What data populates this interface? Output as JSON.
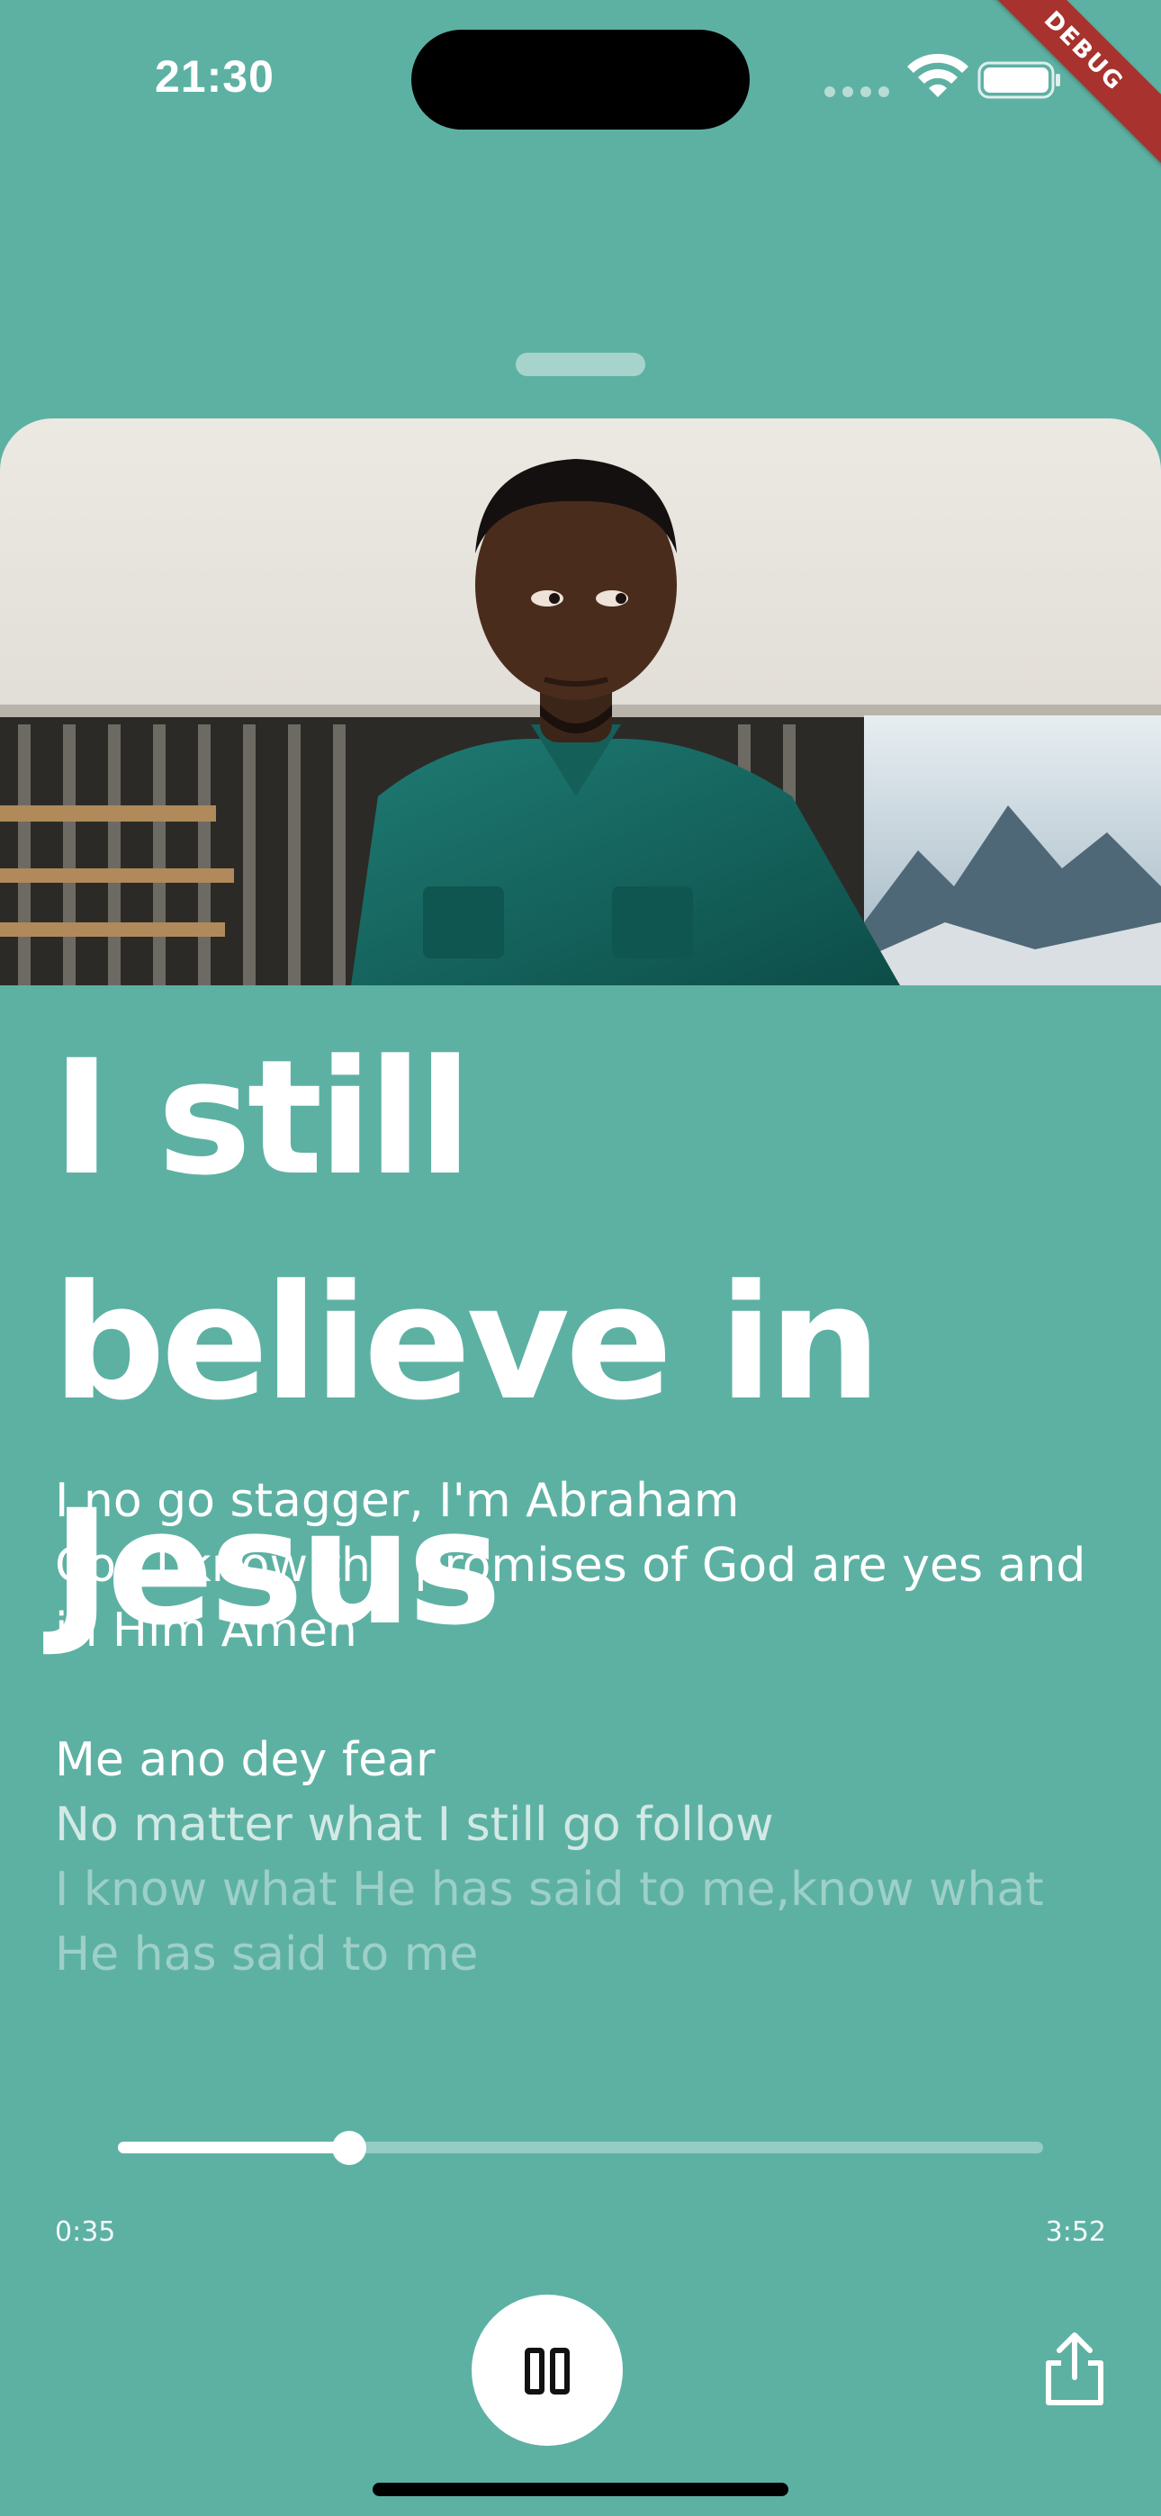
{
  "status_bar": {
    "time": "21:30",
    "debug_label": "DEBUG",
    "icons": [
      "signal-dots-icon",
      "wifi-icon",
      "battery-icon"
    ]
  },
  "song": {
    "title": "I still believe in Jesus",
    "artwork": "artist-photo"
  },
  "lyrics": {
    "lines": [
      "I no go stagger, I'm Abraham",
      "Cos I know the promises of God are yes and in Him Amen",
      "",
      "Me ano dey fear",
      "No matter what I still go follow",
      "I know what He has said to me,know what He has said to me"
    ]
  },
  "player": {
    "elapsed": "0:35",
    "total": "3:52",
    "progress_fraction": 0.25,
    "state": "playing",
    "controls": [
      "pause-icon",
      "share-icon"
    ]
  },
  "colors": {
    "background": "#5db1a3",
    "accent": "#ffffff",
    "debug_ribbon": "#a8322d"
  }
}
